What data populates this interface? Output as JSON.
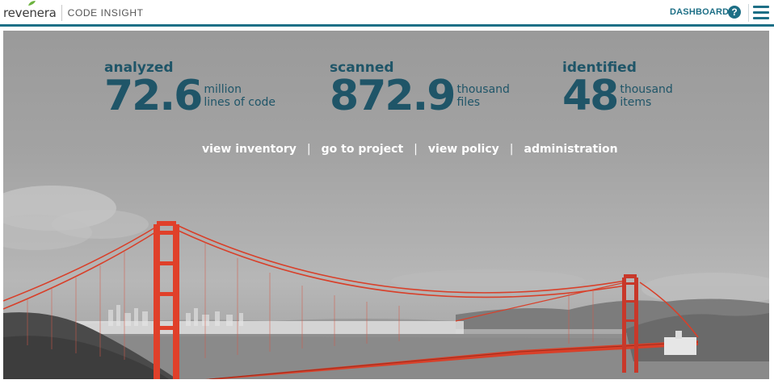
{
  "header": {
    "brand": "revenera",
    "product": "CODE INSIGHT",
    "dashboard_label": "DASHBOARD",
    "help_label": "?",
    "colors": {
      "accent": "#1d6f86",
      "leaf": "#6cb33f"
    }
  },
  "stats": [
    {
      "label": "analyzed",
      "value": "72.6",
      "unit_line1": "million",
      "unit_line2": "lines of code"
    },
    {
      "label": "scanned",
      "value": "872.9",
      "unit_line1": "thousand",
      "unit_line2": "files"
    },
    {
      "label": "identified",
      "value": "48",
      "unit_line1": "thousand",
      "unit_line2": "items"
    }
  ],
  "actions": [
    {
      "label": "view inventory"
    },
    {
      "label": "go to project"
    },
    {
      "label": "view policy"
    },
    {
      "label": "administration"
    }
  ],
  "hero": {
    "description_colors": {
      "sky": "#a3a3a3",
      "bridge": "#e0402a",
      "text": "#1f5568"
    }
  }
}
